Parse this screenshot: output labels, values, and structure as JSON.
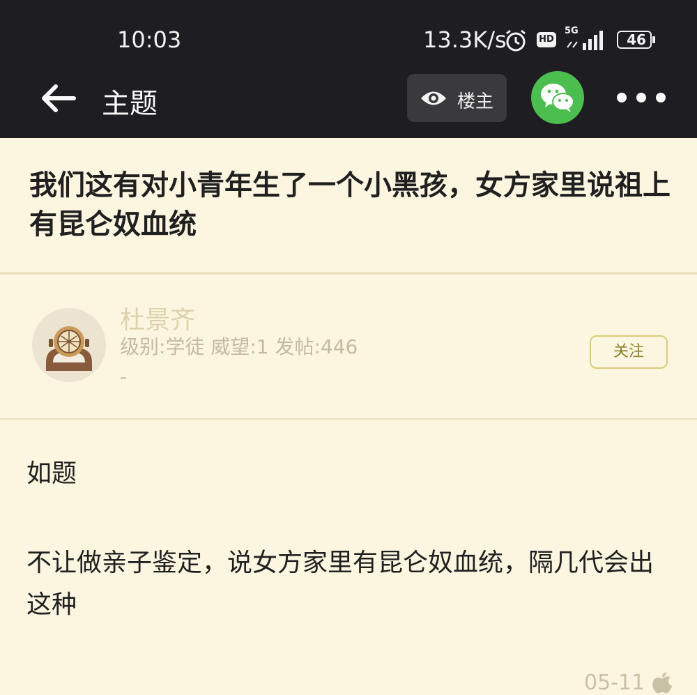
{
  "status_bar": {
    "time": "10:03",
    "net_speed": "13.3K/s",
    "hd_badge": "HD",
    "network": "5G",
    "battery": "46"
  },
  "nav": {
    "title": "主题",
    "owner_only_label": "楼主"
  },
  "post": {
    "title": "我们这有对小青年生了一个小黑孩，女方家里说祖上有昆仑奴血统",
    "author": {
      "name": "杜景齐",
      "meta": "级别:学徒 威望:1 发帖:446",
      "extra": "-"
    },
    "follow_label": "关注",
    "paragraphs": [
      "如题",
      "不让做亲子鉴定，说女方家里有昆仑奴血统，隔几代会出这种"
    ],
    "date": "05-11"
  },
  "colors": {
    "bar_bg": "#1e1e22",
    "page_bg": "#fcf6e1",
    "wechat_green": "#4cbd4f",
    "follow_border": "#d8cc77"
  },
  "icons": [
    "back-arrow-icon",
    "eye-icon",
    "wechat-icon",
    "more-icon",
    "alarm-icon",
    "signal-icon",
    "battery-icon",
    "apple-icon"
  ]
}
